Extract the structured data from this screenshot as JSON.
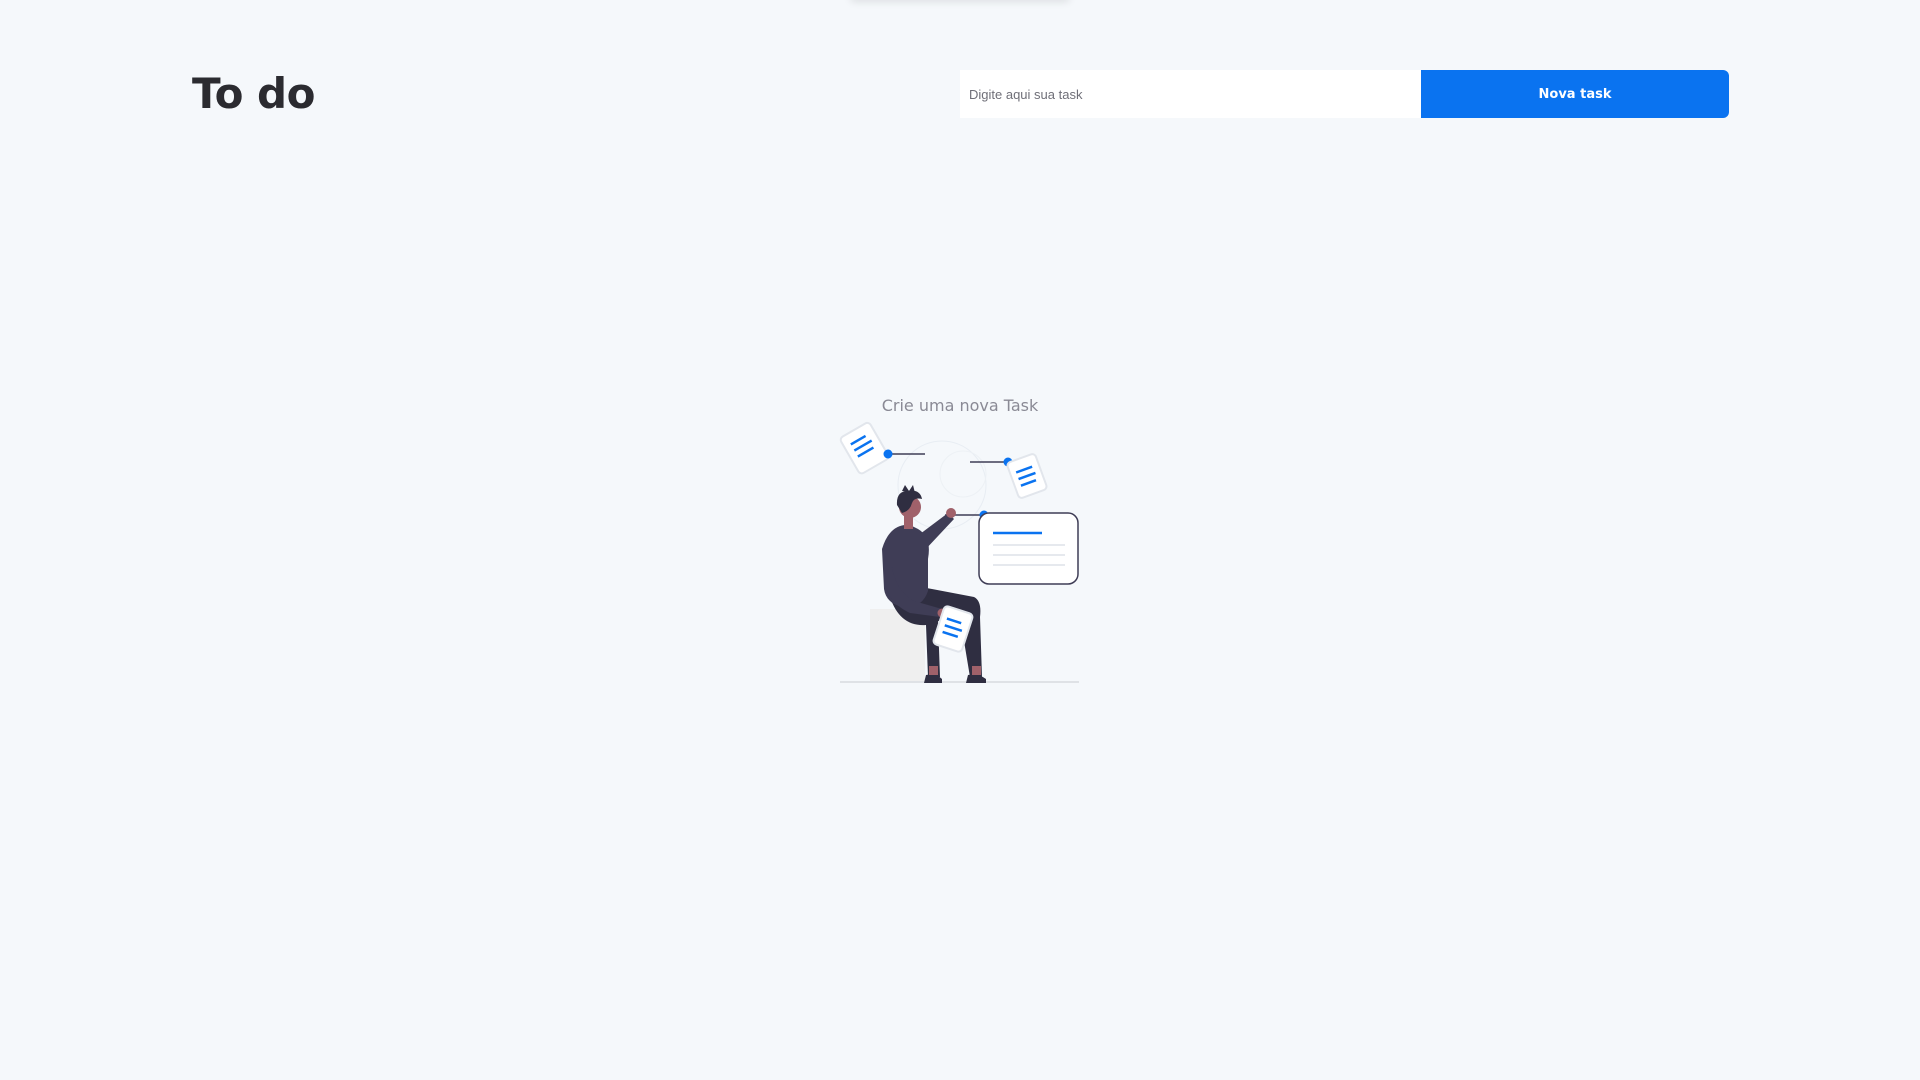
{
  "app": {
    "title": "To do"
  },
  "task_form": {
    "input_placeholder": "Digite aqui sua task",
    "input_value": "",
    "button_label": "Nova task"
  },
  "empty_state": {
    "message": "Crie uma nova Task",
    "illustration": "person-organizing-documents-illustration"
  },
  "colors": {
    "background": "#f5f8fb",
    "accent": "#0a73f0",
    "title": "#2b2b30",
    "muted_text": "#8a8a95"
  }
}
